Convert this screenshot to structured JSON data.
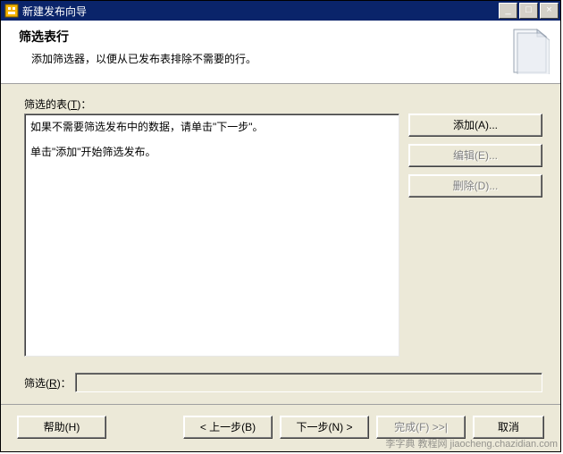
{
  "title": "新建发布向导",
  "header": {
    "title": "筛选表行",
    "sub": "添加筛选器，以便从已发布表排除不需要的行。"
  },
  "labels": {
    "tables": "筛选的表",
    "tables_key": "T",
    "filter": "筛选",
    "filter_key": "R"
  },
  "list": {
    "line1": "如果不需要筛选发布中的数据，请单击\"下一步\"。",
    "line2": "单击\"添加\"开始筛选发布。"
  },
  "side": {
    "add": "添加(A)...",
    "edit": "编辑(E)...",
    "delete": "删除(D)..."
  },
  "footer": {
    "help": "帮助(H)",
    "back": "< 上一步(B)",
    "next": "下一步(N) >",
    "finish": "完成(F) >>|",
    "cancel": "取消"
  },
  "watermark": "李字典 教程网 jiaocheng.chazidian.com"
}
